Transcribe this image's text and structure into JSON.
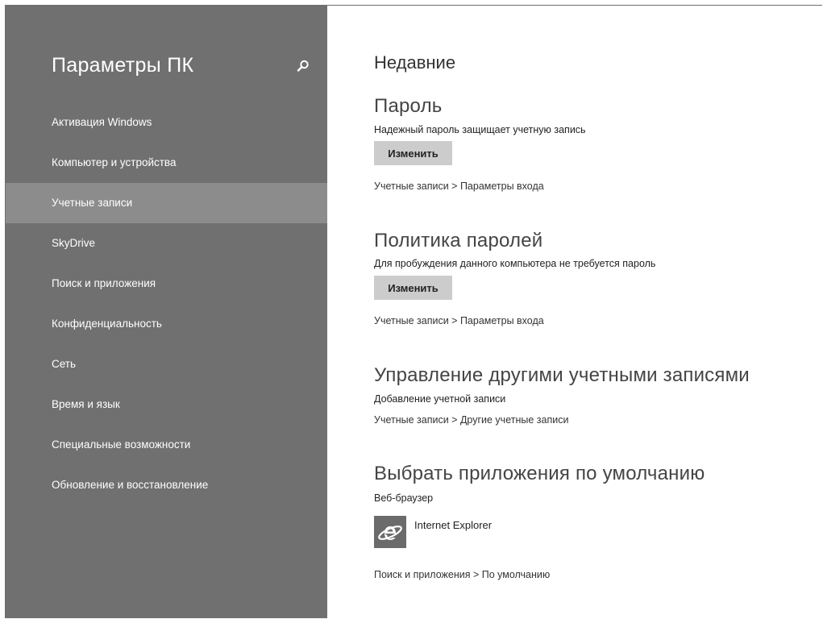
{
  "sidebar": {
    "title": "Параметры ПК",
    "search_icon": "search-icon",
    "items": [
      {
        "label": "Активация Windows"
      },
      {
        "label": "Компьютер и устройства"
      },
      {
        "label": "Учетные записи"
      },
      {
        "label": "SkyDrive"
      },
      {
        "label": "Поиск и приложения"
      },
      {
        "label": "Конфиденциальность"
      },
      {
        "label": "Сеть"
      },
      {
        "label": "Время и язык"
      },
      {
        "label": "Специальные возможности"
      },
      {
        "label": "Обновление и восстановление"
      }
    ],
    "selected_index": 2
  },
  "main": {
    "title": "Недавние",
    "password": {
      "title": "Пароль",
      "description": "Надежный пароль защищает учетную запись",
      "button_label": "Изменить",
      "link": "Учетные записи > Параметры входа"
    },
    "password_policy": {
      "title": "Политика паролей",
      "description": "Для пробуждения данного компьютера не требуется пароль",
      "button_label": "Изменить",
      "link": "Учетные записи > Параметры входа"
    },
    "manage_accounts": {
      "title": "Управление другими учетными записями",
      "description": "Добавление учетной записи",
      "link": "Учетные записи > Другие учетные записи"
    },
    "default_apps": {
      "title": "Выбрать приложения по умолчанию",
      "description": "Веб-браузер",
      "app_name": "Internet Explorer",
      "app_icon": "internet-explorer-icon",
      "link": "Поиск и приложения > По умолчанию"
    }
  },
  "colors": {
    "sidebar_bg": "#707070",
    "sidebar_selected": "#8c8c8c",
    "button_bg": "#cccccc",
    "app_tile_bg": "#6b6b6b"
  }
}
